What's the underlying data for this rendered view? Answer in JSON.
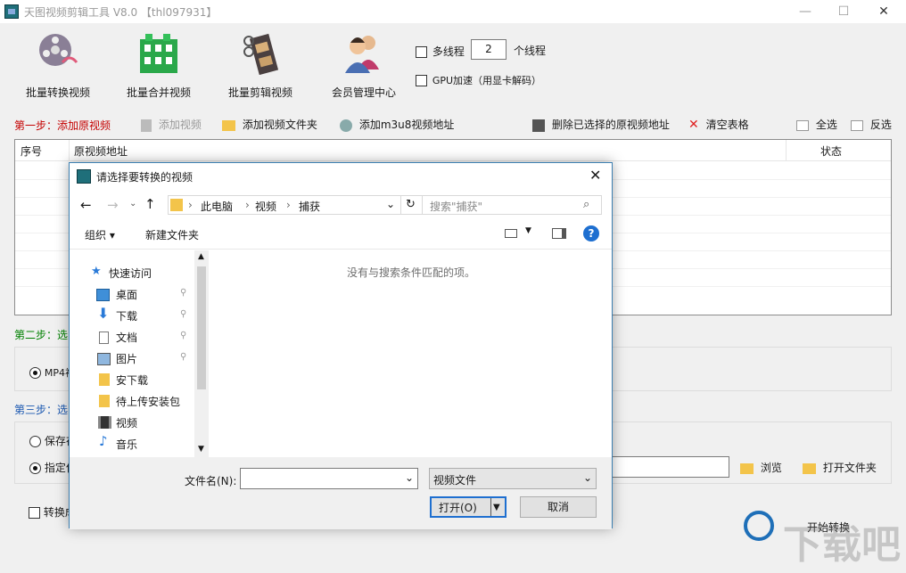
{
  "window": {
    "title": "天图视频剪辑工具 V8.0  【thl097931】",
    "minimize": "—",
    "maximize": "☐",
    "close": "✕"
  },
  "toolbar": {
    "batch_convert": "批量转换视频",
    "batch_merge": "批量合并视频",
    "batch_cut": "批量剪辑视频",
    "member_center": "会员管理中心",
    "multithread_label": "多线程",
    "thread_count": "2",
    "thread_unit": "个线程",
    "gpu_label": "GPU加速（用显卡解码）"
  },
  "step1": {
    "label": "第一步：添加原视频",
    "add_video": "添加视频",
    "add_folder": "添加视频文件夹",
    "add_m3u8": "添加m3u8视频地址",
    "delete_selected": "删除已选择的原视频地址",
    "clear_table": "清空表格",
    "select_all": "全选",
    "invert": "反选"
  },
  "table": {
    "col_index": "序号",
    "col_path": "原视频地址",
    "col_status": "状态"
  },
  "step2": {
    "label": "第二步：选",
    "mp4_label": "MP4视"
  },
  "step3": {
    "label": "第三步：选",
    "save_label": "保存在",
    "specify_label": "指定位",
    "browse": "浏览",
    "open_folder": "打开文件夹"
  },
  "bottom": {
    "convert_check": "转换成",
    "start": "开始转换"
  },
  "watermark": "下载吧",
  "dialog": {
    "title": "请选择要转换的视频",
    "close": "✕",
    "breadcrumb": [
      "此电脑",
      "视频",
      "捕获"
    ],
    "search_placeholder": "搜索\"捕获\"",
    "organize": "组织 ▾",
    "new_folder": "新建文件夹",
    "empty_message": "没有与搜索条件匹配的项。",
    "nav": [
      {
        "label": "快速访问"
      },
      {
        "label": "桌面"
      },
      {
        "label": "下载"
      },
      {
        "label": "文档"
      },
      {
        "label": "图片"
      },
      {
        "label": "安下载"
      },
      {
        "label": "待上传安装包"
      },
      {
        "label": "视频"
      },
      {
        "label": "音乐"
      }
    ],
    "filename_label": "文件名(N):",
    "filename_value": "",
    "filetype_value": "视频文件",
    "open_button": "打开(O)",
    "cancel_button": "取消"
  }
}
